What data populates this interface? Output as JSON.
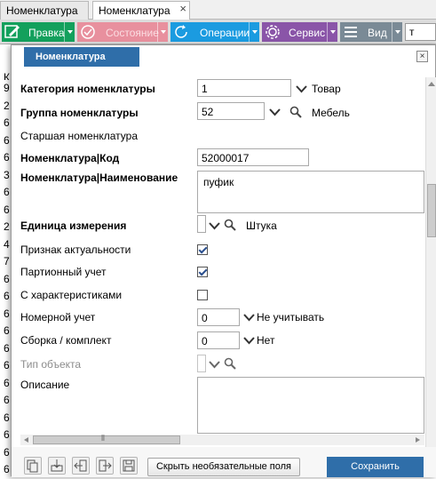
{
  "tabs": [
    {
      "label": "Номенклатура"
    },
    {
      "label": "Номенклатура",
      "close": "×"
    }
  ],
  "toolbar": {
    "edit_label": "Правка",
    "state_label": "Состояние",
    "operations_label": "Операции",
    "service_label": "Сервис",
    "view_label": "Вид",
    "search_value": "т",
    "colors": {
      "edit": "#13a05c",
      "state": "#e8909e",
      "operations": "#1b9be0",
      "service": "#8a55a8",
      "view": "#7a8a96"
    }
  },
  "background_list": [
    "К",
    "9",
    "2",
    "6",
    "6",
    "6",
    "3",
    "6",
    "6",
    "2",
    "4",
    "7",
    "6",
    "6",
    "6",
    "6",
    "6",
    "6",
    "6",
    "6",
    "6",
    "6",
    "6",
    "6"
  ],
  "dialog": {
    "title": "Номенклатура",
    "close": "×",
    "fields": {
      "category": {
        "label": "Категория номенклатуры",
        "value": "1",
        "display": "Товар"
      },
      "group": {
        "label": "Группа номенклатуры",
        "value": "52",
        "display": "Мебель"
      },
      "senior": {
        "label": "Старшая номенклатура"
      },
      "code": {
        "label": "Номенклатура|Код",
        "value": "52000017"
      },
      "name": {
        "label": "Номенклатура|Наименование",
        "value": "пуфик"
      },
      "unit": {
        "label": "Единица измерения",
        "value": "",
        "display": "Штука"
      },
      "actual": {
        "label": "Признак актуальности",
        "checked": true
      },
      "batch": {
        "label": "Партионный учет",
        "checked": true
      },
      "characteristics": {
        "label": "С характеристиками",
        "checked": false
      },
      "serial": {
        "label": "Номерной учет",
        "value": "0",
        "display": "Не учитывать"
      },
      "assembly": {
        "label": "Сборка / комплект",
        "value": "0",
        "display": "Нет"
      },
      "object_type": {
        "label": "Тип объекта",
        "value": ""
      },
      "description": {
        "label": "Описание",
        "value": ""
      }
    },
    "hscroll_grip": "⦀",
    "buttons": {
      "hide_optional": "Скрыть необязательные поля",
      "save": "Сохранить"
    },
    "accent_color": "#2f6ea9"
  }
}
